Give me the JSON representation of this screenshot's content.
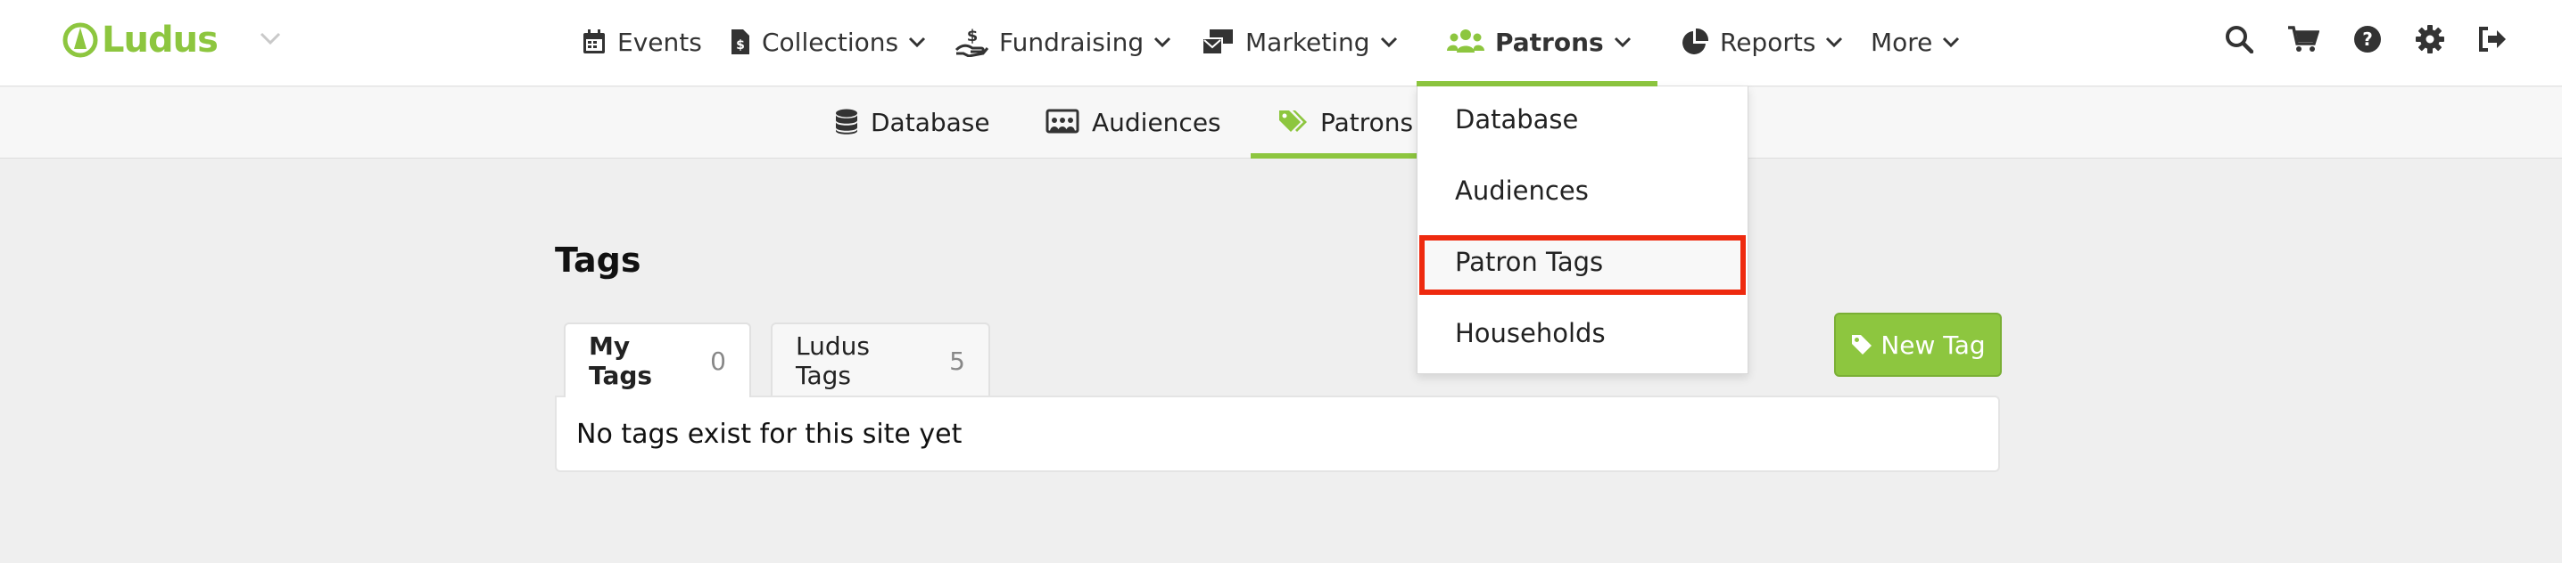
{
  "brand": {
    "name": "Ludus",
    "color": "#8dc63f"
  },
  "topnav": {
    "items": [
      {
        "id": "events",
        "label": "Events",
        "icon": "calendar-icon"
      },
      {
        "id": "collections",
        "label": "Collections",
        "icon": "file-invoice-icon"
      },
      {
        "id": "fundraising",
        "label": "Fundraising",
        "icon": "hand-holding-dollar-icon"
      },
      {
        "id": "marketing",
        "label": "Marketing",
        "icon": "mail-bulk-icon"
      },
      {
        "id": "patrons",
        "label": "Patrons",
        "icon": "users-icon",
        "active": true
      },
      {
        "id": "reports",
        "label": "Reports",
        "icon": "pie-chart-icon"
      },
      {
        "id": "more",
        "label": "More"
      }
    ],
    "utility_icons": [
      "search-icon",
      "cart-icon",
      "help-icon",
      "gear-icon",
      "sign-out-icon"
    ]
  },
  "subnav": {
    "items": [
      {
        "label": "Database",
        "icon": "database-icon"
      },
      {
        "label": "Audiences",
        "icon": "audiences-icon"
      },
      {
        "label": "Patrons",
        "icon": "tags-icon",
        "active": true
      }
    ]
  },
  "dropdown": {
    "items": [
      "Database",
      "Audiences",
      "Patron Tags",
      "Households"
    ],
    "highlighted": "Patron Tags",
    "highlight_color": "#ee2a0f"
  },
  "page": {
    "title": "Tags",
    "tabs": [
      {
        "label": "My Tags",
        "count": "0",
        "active": true
      },
      {
        "label": "Ludus Tags",
        "count": "5"
      }
    ],
    "empty_message": "No tags exist for this site yet",
    "new_tag_label": "New Tag"
  }
}
